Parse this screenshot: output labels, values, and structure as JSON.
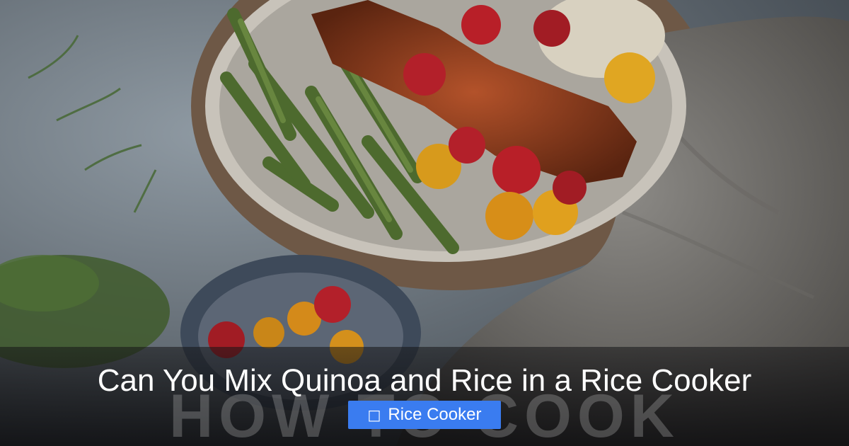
{
  "article": {
    "title": "Can You Mix Quinoa and Rice in a Rice Cooker",
    "category": {
      "icon": "tag-icon",
      "icon_glyph": "□",
      "label": "Rice Cooker"
    },
    "watermark": "HOW TO COOK"
  },
  "colors": {
    "badge_bg": "#3a7cf0",
    "title_text": "#ffffff"
  }
}
